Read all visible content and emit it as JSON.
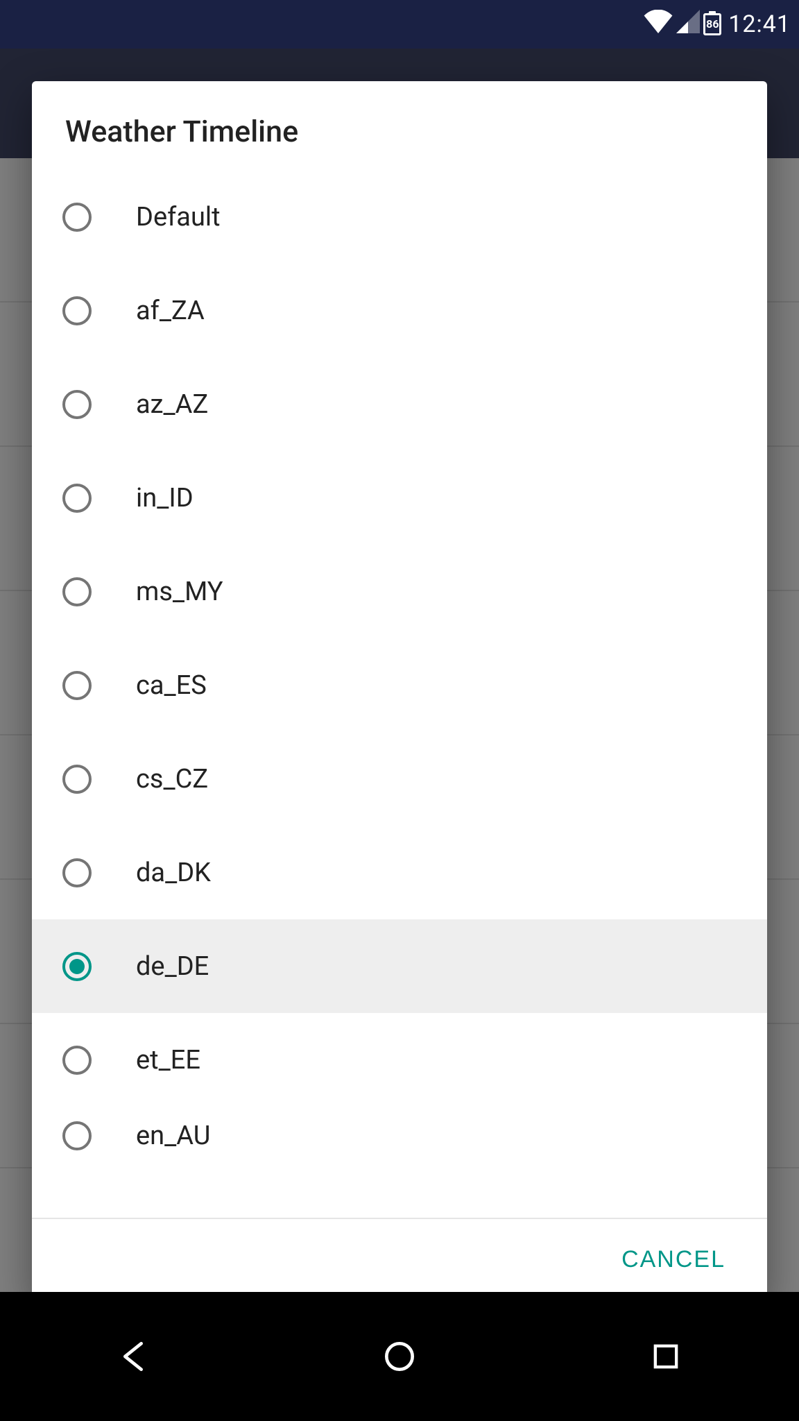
{
  "status_bar": {
    "battery_level": "86",
    "time": "12:41"
  },
  "dialog": {
    "title": "Weather Timeline",
    "selected_index": 8,
    "options": [
      {
        "label": "Default"
      },
      {
        "label": "af_ZA"
      },
      {
        "label": "az_AZ"
      },
      {
        "label": "in_ID"
      },
      {
        "label": "ms_MY"
      },
      {
        "label": "ca_ES"
      },
      {
        "label": "cs_CZ"
      },
      {
        "label": "da_DK"
      },
      {
        "label": "de_DE"
      },
      {
        "label": "et_EE"
      },
      {
        "label": "en_AU"
      }
    ],
    "cancel_label": "CANCEL"
  }
}
